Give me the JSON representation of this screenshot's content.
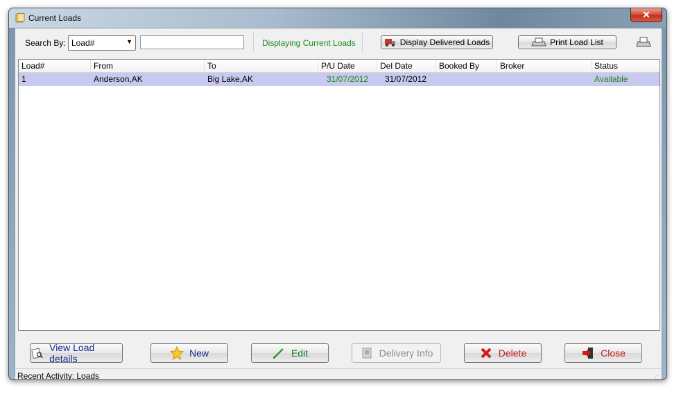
{
  "window": {
    "title": "Current Loads"
  },
  "toolbar": {
    "search_label": "Search By:",
    "search_by_value": "Load#",
    "search_input_value": "",
    "status_text": "Displaying Current Loads",
    "display_delivered_label": "Display Delivered Loads",
    "print_list_label": "Print Load List"
  },
  "grid": {
    "columns": [
      "Load#",
      "From",
      "To",
      "P/U Date",
      "Del Date",
      "Booked By",
      "Broker",
      "Status"
    ],
    "rows": [
      {
        "load": "1",
        "from": "Anderson,AK",
        "to": "Big Lake,AK",
        "pu_date": "31/07/2012",
        "del_date": "31/07/2012",
        "booked_by": "",
        "broker": "",
        "status": "Available"
      }
    ]
  },
  "buttons": {
    "view": "View Load details",
    "new": "New",
    "edit": "Edit",
    "delivery": "Delivery Info",
    "delete": "Delete",
    "close": "Close"
  },
  "statusbar": {
    "recent": "Recent Activity:  Loads"
  },
  "colors": {
    "accent_green": "#1a8a1a",
    "selected_row": "#c9c9f0",
    "delete_red": "#c41a1a"
  }
}
